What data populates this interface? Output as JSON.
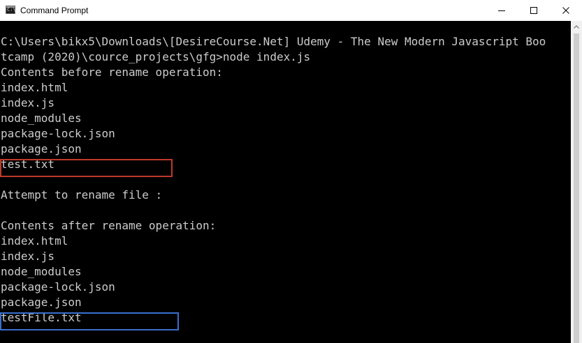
{
  "window": {
    "title": "Command Prompt",
    "app_icon": "cmd-icon",
    "app_icon_glyph": "C:\\",
    "controls": {
      "minimize_icon": "minimize-icon",
      "maximize_icon": "maximize-icon",
      "close_icon": "close-icon"
    }
  },
  "console": {
    "background": "#000000",
    "text_color": "#cccccc",
    "lines": [
      "C:\\Users\\bikx5\\Downloads\\[DesireCourse.Net] Udemy - The New Modern Javascript Boo",
      "tcamp (2020)\\cource_projects\\gfg>node index.js",
      "Contents before rename operation:",
      "index.html",
      "index.js",
      "node_modules",
      "package-lock.json",
      "package.json",
      "test.txt",
      "",
      "Attempt to rename file :",
      "",
      "Contents after rename operation:",
      "index.html",
      "index.js",
      "node_modules",
      "package-lock.json",
      "package.json",
      "testFile.txt"
    ]
  },
  "annotations": {
    "before_highlight_color": "#c0392b",
    "after_highlight_color": "#3a6fcf"
  }
}
